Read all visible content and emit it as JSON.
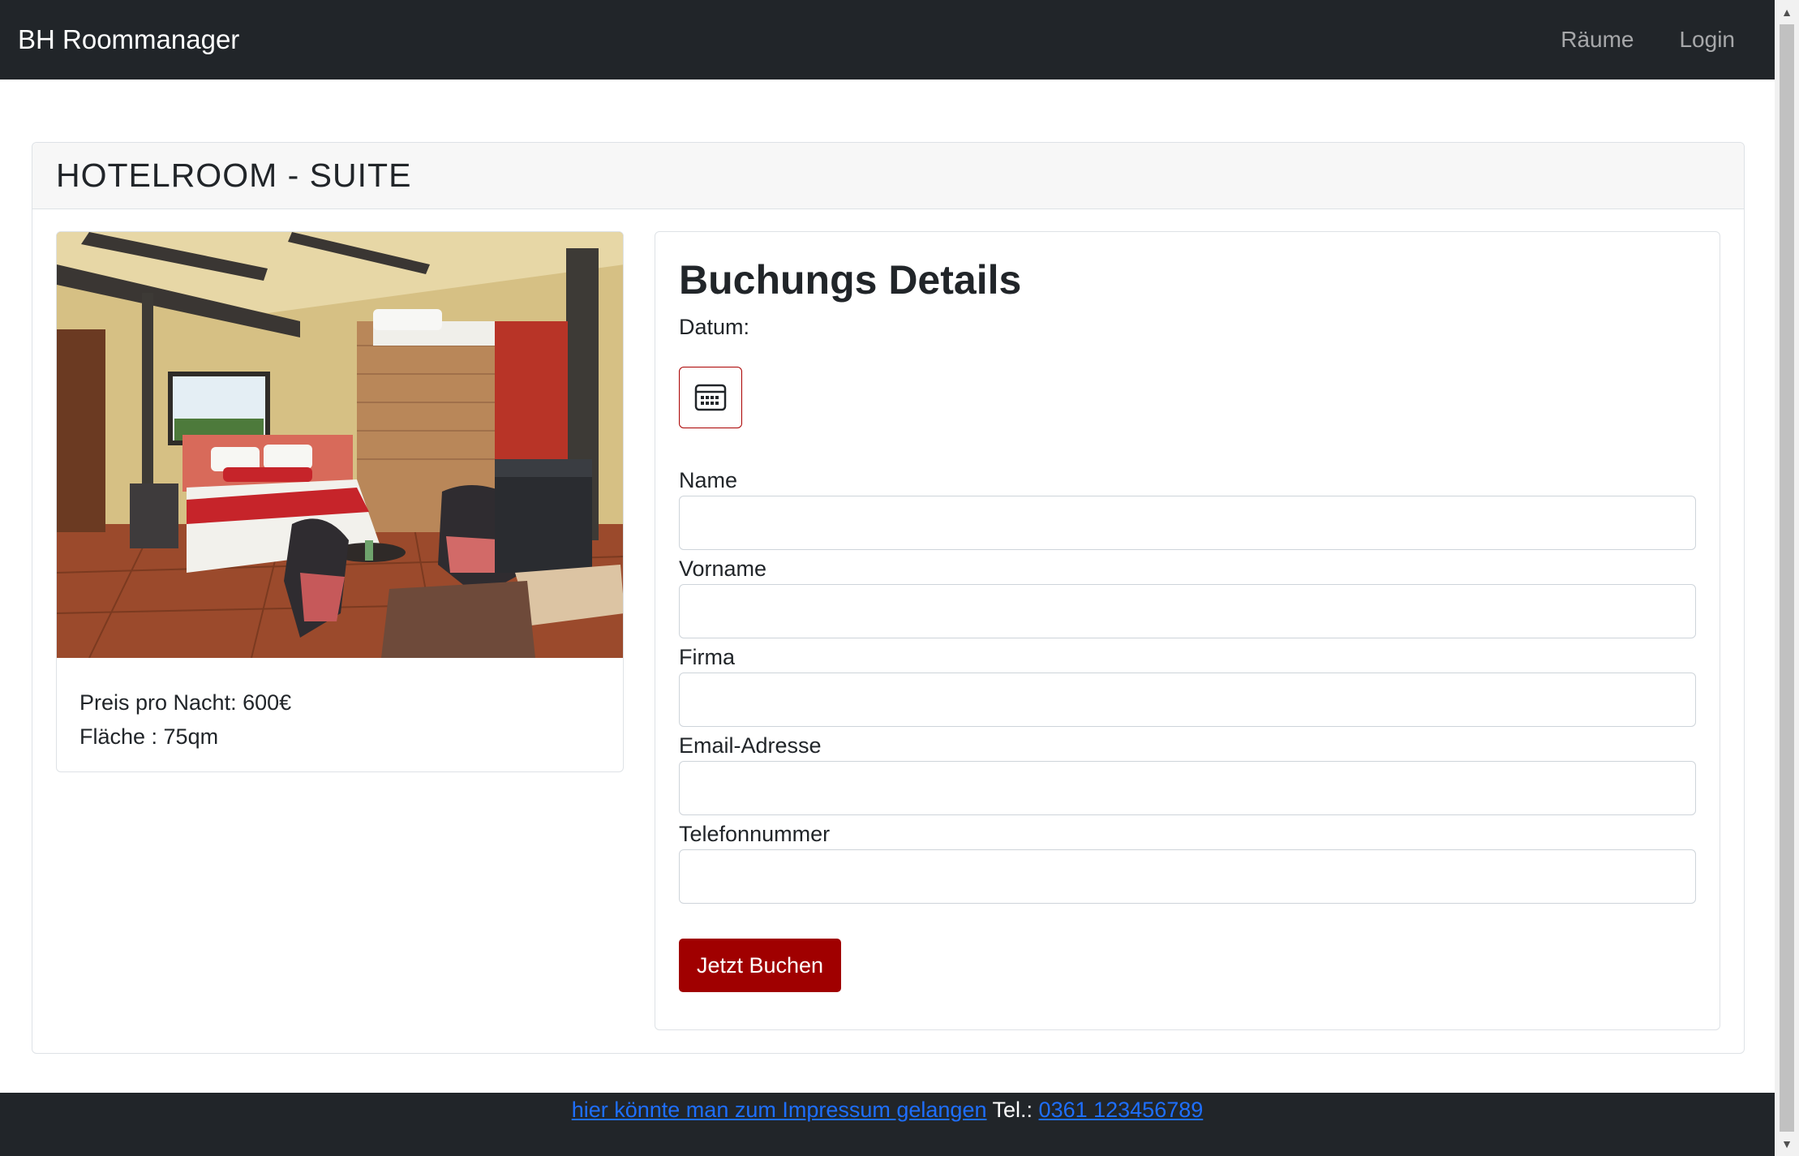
{
  "navbar": {
    "brand": "BH Roommanager",
    "links": [
      "Räume",
      "Login"
    ]
  },
  "room": {
    "title": "HOTELROOM - SUITE",
    "price_text": "Preis pro Nacht: 600€",
    "area_text": "Fläche : 75qm"
  },
  "booking": {
    "title": "Buchungs Details",
    "date_label": "Datum:",
    "fields": {
      "name": "Name",
      "vorname": "Vorname",
      "firma": "Firma",
      "email": "Email-Adresse",
      "telefon": "Telefonnummer"
    },
    "submit_label": "Jetzt Buchen"
  },
  "footer": {
    "impressum_link": "hier könnte man zum Impressum gelangen",
    "tel_label": "Tel.:",
    "phone": "0361 123456789"
  },
  "colors": {
    "navbar_bg": "#212529",
    "accent": "#a00000",
    "link": "#1e6fff"
  }
}
